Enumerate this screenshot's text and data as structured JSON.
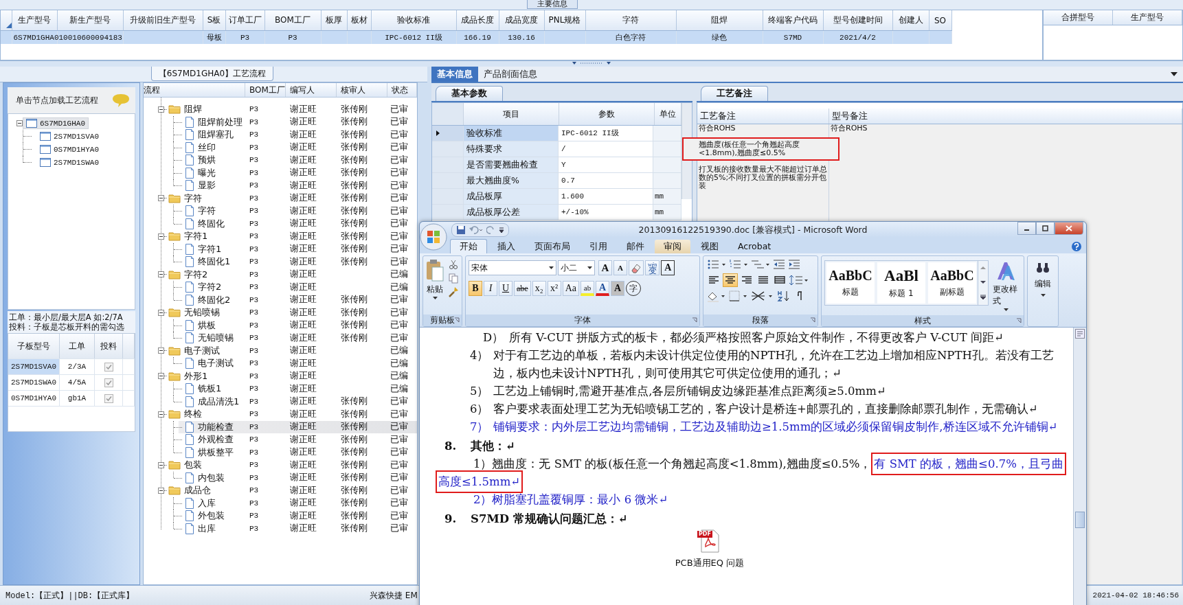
{
  "main_panel": {
    "title": "主要信息"
  },
  "orders": {
    "columns": [
      "生产型号",
      "新生产型号",
      "升级前旧生产型号",
      "S板",
      "订单工厂",
      "BOM工厂",
      "板厚",
      "板材",
      "验收标准",
      "成品长度",
      "成品宽度",
      "PNL规格",
      "字符",
      "阻焊",
      "终端客户代码",
      "型号创建时间",
      "创建人",
      "SO"
    ],
    "rows": [
      {
        "selected": true,
        "cells": [
          "6S7MD1GHA0",
          "10010600094183",
          null,
          "母板",
          "P3",
          "P3",
          null,
          null,
          "IPC-6012 II级",
          "166.19",
          "130.16",
          null,
          "白色字符",
          "绿色",
          "S7MD",
          "2021/4/2",
          null,
          null
        ]
      }
    ]
  },
  "merge": {
    "columns": [
      "合拼型号",
      "生产型号"
    ]
  },
  "flow_panel": {
    "title": "【6S7MD1GHA0】工艺流程"
  },
  "models": {
    "hint": "单击节点加载工艺流程",
    "tree": [
      {
        "label": "6S7MD1GHA0",
        "expanded": true,
        "selected": true,
        "children": [
          {
            "label": "2S7MD1SVA0",
            "selected": false
          },
          {
            "label": "0S7MD1HYA0",
            "selected": false
          },
          {
            "label": "2S7MD1SWA0",
            "selected": false
          }
        ]
      }
    ],
    "notes": [
      "工单：最小层/最大层A 如:2/7A",
      "投料：子板是芯板开料的需勾选"
    ],
    "columns": [
      "子板型号",
      "工单",
      "投料"
    ],
    "rows": [
      {
        "model": "2S7MD1SVA0",
        "order": "2/3A",
        "checked": true,
        "selected": true
      },
      {
        "model": "2S7MD1SWA0",
        "order": "4/5A",
        "checked": true,
        "selected": false
      },
      {
        "model": "0S7MD1HYA0",
        "order": "gb1A",
        "checked": true,
        "selected": false
      }
    ]
  },
  "process": {
    "columns": [
      "流程",
      "BOM工厂",
      "编写人",
      "核审人",
      "状态"
    ],
    "rows": [
      {
        "label": "阻焊",
        "factory": "P3",
        "author": "谢正旺",
        "reviewer": "张传刚",
        "status": "已审",
        "expanded": true,
        "selected": false,
        "children": [
          {
            "label": "阻焊前处理",
            "factory": "P3",
            "author": "谢正旺",
            "reviewer": "张传刚",
            "status": "已审",
            "selected": false
          },
          {
            "label": "阻焊塞孔",
            "factory": "P3",
            "author": "谢正旺",
            "reviewer": "张传刚",
            "status": "已审",
            "selected": false
          },
          {
            "label": "丝印",
            "factory": "P3",
            "author": "谢正旺",
            "reviewer": "张传刚",
            "status": "已审",
            "selected": false
          },
          {
            "label": "预烘",
            "factory": "P3",
            "author": "谢正旺",
            "reviewer": "张传刚",
            "status": "已审",
            "selected": false
          },
          {
            "label": "曝光",
            "factory": "P3",
            "author": "谢正旺",
            "reviewer": "张传刚",
            "status": "已审",
            "selected": false
          },
          {
            "label": "显影",
            "factory": "P3",
            "author": "谢正旺",
            "reviewer": "张传刚",
            "status": "已审",
            "selected": false
          }
        ]
      },
      {
        "label": "字符",
        "factory": "P3",
        "author": "谢正旺",
        "reviewer": "张传刚",
        "status": "已审",
        "expanded": true,
        "selected": false,
        "children": [
          {
            "label": "字符",
            "factory": "P3",
            "author": "谢正旺",
            "reviewer": "张传刚",
            "status": "已审",
            "selected": false
          },
          {
            "label": "终固化",
            "factory": "P3",
            "author": "谢正旺",
            "reviewer": "张传刚",
            "status": "已审",
            "selected": false
          }
        ]
      },
      {
        "label": "字符1",
        "factory": "P3",
        "author": "谢正旺",
        "reviewer": "张传刚",
        "status": "已审",
        "expanded": true,
        "selected": false,
        "children": [
          {
            "label": "字符1",
            "factory": "P3",
            "author": "谢正旺",
            "reviewer": "张传刚",
            "status": "已审",
            "selected": false
          },
          {
            "label": "终固化1",
            "factory": "P3",
            "author": "谢正旺",
            "reviewer": "张传刚",
            "status": "已审",
            "selected": false
          }
        ]
      },
      {
        "label": "字符2",
        "factory": "P3",
        "author": "谢正旺",
        "status": "已编",
        "expanded": true,
        "selected": false,
        "children": [
          {
            "label": "字符2",
            "factory": "P3",
            "author": "谢正旺",
            "status": "已编",
            "selected": false
          },
          {
            "label": "终固化2",
            "factory": "P3",
            "author": "谢正旺",
            "reviewer": "张传刚",
            "status": "已审",
            "selected": false
          }
        ]
      },
      {
        "label": "无铅喷锡",
        "factory": "P3",
        "author": "谢正旺",
        "reviewer": "张传刚",
        "status": "已审",
        "expanded": true,
        "selected": false,
        "children": [
          {
            "label": "烘板",
            "factory": "P3",
            "author": "谢正旺",
            "reviewer": "张传刚",
            "status": "已审",
            "selected": false
          },
          {
            "label": "无铅喷锡",
            "factory": "P3",
            "author": "谢正旺",
            "reviewer": "张传刚",
            "status": "已审",
            "selected": false
          }
        ]
      },
      {
        "label": "电子测试",
        "factory": "P3",
        "author": "谢正旺",
        "status": "已编",
        "expanded": true,
        "selected": false,
        "children": [
          {
            "label": "电子测试",
            "factory": "P3",
            "author": "谢正旺",
            "status": "已编",
            "selected": false
          }
        ]
      },
      {
        "label": "外形1",
        "factory": "P3",
        "author": "谢正旺",
        "status": "已编",
        "expanded": true,
        "selected": false,
        "children": [
          {
            "label": "铣板1",
            "factory": "P3",
            "author": "谢正旺",
            "status": "已编",
            "selected": false
          },
          {
            "label": "成品清洗1",
            "factory": "P3",
            "author": "谢正旺",
            "reviewer": "张传刚",
            "status": "已审",
            "selected": false
          }
        ]
      },
      {
        "label": "终检",
        "factory": "P3",
        "author": "谢正旺",
        "reviewer": "张传刚",
        "status": "已审",
        "expanded": true,
        "selected": false,
        "children": [
          {
            "label": "功能检查",
            "factory": "P3",
            "author": "谢正旺",
            "reviewer": "张传刚",
            "status": "已审",
            "selected": true
          },
          {
            "label": "外观检查",
            "factory": "P3",
            "author": "谢正旺",
            "reviewer": "张传刚",
            "status": "已审",
            "selected": false
          },
          {
            "label": "烘板整平",
            "factory": "P3",
            "author": "谢正旺",
            "reviewer": "张传刚",
            "status": "已审",
            "selected": false
          }
        ]
      },
      {
        "label": "包装",
        "factory": "P3",
        "author": "谢正旺",
        "reviewer": "张传刚",
        "status": "已审",
        "expanded": true,
        "selected": false,
        "children": [
          {
            "label": "内包装",
            "factory": "P3",
            "author": "谢正旺",
            "reviewer": "张传刚",
            "status": "已审",
            "selected": false
          }
        ]
      },
      {
        "label": "成品仓",
        "factory": "P3",
        "author": "谢正旺",
        "reviewer": "张传刚",
        "status": "已审",
        "expanded": true,
        "selected": false,
        "children": [
          {
            "label": "入库",
            "factory": "P3",
            "author": "谢正旺",
            "reviewer": "张传刚",
            "status": "已审",
            "selected": false
          },
          {
            "label": "外包装",
            "factory": "P3",
            "author": "谢正旺",
            "reviewer": "张传刚",
            "status": "已审",
            "selected": false
          },
          {
            "label": "出库",
            "factory": "P3",
            "author": "谢正旺",
            "reviewer": "张传刚",
            "status": "已审",
            "selected": false
          }
        ]
      }
    ]
  },
  "detail": {
    "tabs": [
      {
        "label": "基本信息",
        "selected": true
      },
      {
        "label": "产品剖面信息",
        "selected": false
      }
    ],
    "params": {
      "tab": "基本参数",
      "columns": [
        "项目",
        "参数",
        "单位"
      ],
      "rows": [
        {
          "item": "验收标准",
          "value": "IPC-6012 II级",
          "selected": true
        },
        {
          "item": "特殊要求",
          "value": "/",
          "selected": false
        },
        {
          "item": "是否需要翘曲检查",
          "value": "Y",
          "selected": false
        },
        {
          "item": "最大翘曲度%",
          "value": "0.7",
          "selected": false
        },
        {
          "item": "成品板厚",
          "value": "1.600",
          "unit": "mm",
          "selected": false
        },
        {
          "item": "成品板厚公差",
          "value": "+/-10%",
          "unit": "mm",
          "selected": false
        }
      ]
    },
    "remarks": {
      "tab": "工艺备注",
      "columns": [
        "工艺备注",
        "型号备注"
      ],
      "process_notes": [
        {
          "text": "符合ROHS",
          "highlighted": false
        },
        {
          "text": "翘曲度(板任意一个角翘起高度<1.8mm),翘曲度≤0.5%",
          "highlighted": true
        },
        {
          "text": "打叉板的接收数量最大不能超过订单总数的5%;不同打叉位置的拼板需分开包装",
          "highlighted": false
        }
      ],
      "model_notes": [
        "符合ROHS"
      ]
    }
  },
  "word": {
    "title": "20130916122519390.doc [兼容模式] - Microsoft Word",
    "tabs": [
      {
        "label": "开始",
        "selected": true,
        "hovered": false
      },
      {
        "label": "插入",
        "selected": false,
        "hovered": false
      },
      {
        "label": "页面布局",
        "selected": false,
        "hovered": false
      },
      {
        "label": "引用",
        "selected": false,
        "hovered": false
      },
      {
        "label": "邮件",
        "selected": false,
        "hovered": false
      },
      {
        "label": "审阅",
        "selected": false,
        "hovered": true
      },
      {
        "label": "视图",
        "selected": false,
        "hovered": false
      },
      {
        "label": "Acrobat",
        "selected": false,
        "hovered": false
      }
    ],
    "clipboard": {
      "paste": "粘贴",
      "group": "剪贴板"
    },
    "font": {
      "group": "字体",
      "name": "宋体",
      "size": "小二",
      "row1": [
        {
          "kind": "grow",
          "glyph": "A"
        },
        {
          "kind": "shrink",
          "glyph": "A"
        },
        {
          "kind": "clear"
        },
        {
          "kind": "phonetic",
          "glyph": "变",
          "ruby": "wén"
        },
        {
          "kind": "border",
          "glyph": "A"
        }
      ],
      "row2": [
        {
          "kind": "bold",
          "glyph": "B",
          "selected": true
        },
        {
          "kind": "italic",
          "glyph": "I",
          "selected": false
        },
        {
          "kind": "underline",
          "glyph": "U",
          "selected": false
        },
        {
          "kind": "strike",
          "glyph": "abe",
          "selected": false
        },
        {
          "kind": "plain",
          "glyph": "x₂",
          "selected": false
        },
        {
          "kind": "plain",
          "glyph": "x²",
          "selected": false
        },
        {
          "kind": "plain",
          "glyph": "Aa",
          "selected": false
        },
        {
          "kind": "highlight",
          "glyph": "ab",
          "selected": false
        },
        {
          "kind": "color",
          "glyph": "A",
          "selected": false
        },
        {
          "kind": "shade",
          "glyph": "A",
          "selected": false
        },
        {
          "kind": "enclose",
          "glyph": "字",
          "selected": false
        }
      ]
    },
    "paragraph": {
      "group": "段落",
      "align": [
        {
          "kind": "left",
          "selected": false
        },
        {
          "kind": "center",
          "selected": true
        },
        {
          "kind": "right",
          "selected": false
        },
        {
          "kind": "justify",
          "selected": false
        },
        {
          "kind": "distribute",
          "selected": false
        }
      ]
    },
    "styles": {
      "group": "样式",
      "items": [
        {
          "sample": "AaBbC",
          "label": "标题"
        },
        {
          "sample": "AaBl",
          "label": "标题 1"
        },
        {
          "sample": "AaBbC",
          "label": "副标题"
        }
      ],
      "change": "更改样式"
    },
    "editing": {
      "label": "编辑"
    }
  },
  "document": {
    "paragraphs": [
      {
        "kind": "subitem",
        "num": "D）",
        "parts": [
          {
            "text": "所有 V-CUT 拼版方式的板卡，都必须严格按照客户原始文件制作，不得更改客户 V-CUT 间距↵"
          }
        ]
      },
      {
        "kind": "item",
        "num": "4）",
        "parts": [
          {
            "text": "对于有工艺边的单板，若板内未设计供定位使用的NPTH孔，允许在工艺边上增加相应NPTH孔。若没有工艺边，板内也未设计NPTH孔，则可使用其它可供定位使用的通孔；↵"
          }
        ]
      },
      {
        "kind": "item",
        "num": "5）",
        "parts": [
          {
            "text": "工艺边上铺铜时,需避开基准点,各层所铺铜皮边缘距基准点距离须≥5.0mm↵"
          }
        ]
      },
      {
        "kind": "item",
        "num": "6）",
        "parts": [
          {
            "text": "客户要求表面处理工艺为无铅喷锡工艺的，客户设计是桥连+邮票孔的，直接删除邮票孔制作，无需确认↵"
          }
        ]
      },
      {
        "kind": "item",
        "num": "7）",
        "parts": [
          {
            "text": "铺铜要求：内外层工艺边均需铺铜，工艺边及辅助边≥1.5mm的区域必须保留铜皮制作,桥连区域不允许铺铜↵",
            "color": "#2323c8"
          }
        ]
      },
      {
        "kind": "heading",
        "num": "8.",
        "parts": [
          {
            "text": "其他：↵"
          }
        ]
      },
      {
        "kind": "body",
        "parts": [
          {
            "text": "1）翘曲度：无 SMT 的板(板任意一个角翘起高度<1.8mm),翘曲度≤0.5%，"
          },
          {
            "text": "有 SMT 的板，翘曲≤0.7%，且弓曲高度≤1.5mm↵",
            "color": "#2323c8",
            "highlighted": true
          }
        ]
      },
      {
        "kind": "body",
        "parts": [
          {
            "text": "2）树脂塞孔盖覆铜厚：最小 6 微米↵",
            "color": "#2323c8"
          }
        ]
      },
      {
        "kind": "heading",
        "num": "9.",
        "parts": [
          {
            "text": "S7MD 常规确认问题汇总：↵"
          }
        ]
      }
    ],
    "attachment": {
      "badge": "PDF",
      "label": "PCB通用EQ 问题"
    }
  },
  "status_bar": {
    "left": "Model:【正式】||DB:【正式库】",
    "center": "兴森快捷 EM",
    "time": "2021-04-02 18:46:56"
  }
}
